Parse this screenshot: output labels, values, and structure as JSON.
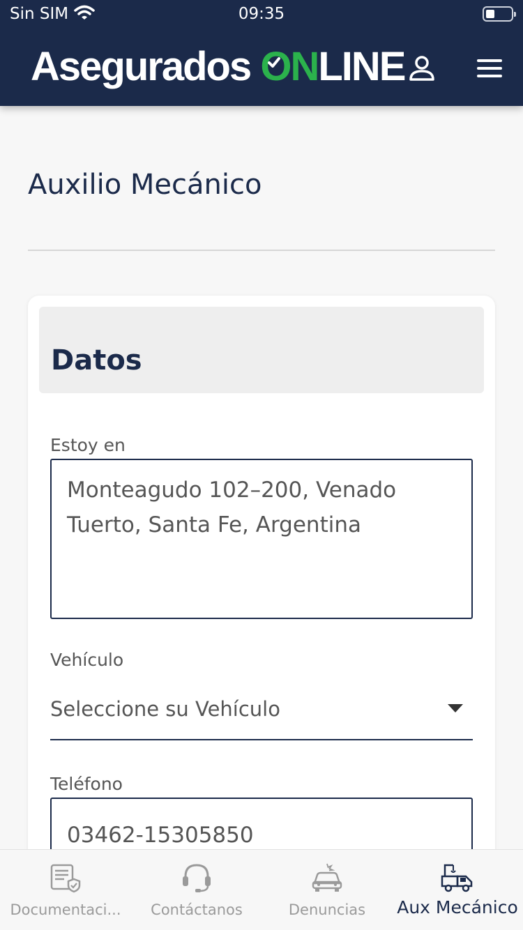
{
  "status_bar": {
    "carrier": "Sin SIM",
    "time": "09:35"
  },
  "header": {
    "logo_part1": "Asegurados",
    "logo_o": "O",
    "logo_n": "N",
    "logo_rest": "LINE",
    "icons": [
      "user-icon",
      "hamburger-menu-icon"
    ]
  },
  "page": {
    "title": "Auxilio Mecánico"
  },
  "card": {
    "section_title": "Datos",
    "location": {
      "label": "Estoy en",
      "value": "Monteagudo 102–200, Venado Tuerto, Santa Fe, Argentina"
    },
    "vehicle": {
      "label": "Vehículo",
      "selected": "Seleccione su Vehículo"
    },
    "phone": {
      "label": "Teléfono",
      "value": "03462-15305850"
    }
  },
  "tabbar": {
    "items": [
      {
        "label": "Documentaci...",
        "icon": "document-shield-icon",
        "active": false
      },
      {
        "label": "Contáctanos",
        "icon": "headset-icon",
        "active": false
      },
      {
        "label": "Denuncias",
        "icon": "car-crash-icon",
        "active": false
      },
      {
        "label": "Aux Mecánico",
        "icon": "tow-truck-icon",
        "active": true
      }
    ]
  },
  "colors": {
    "primary": "#1b2a4a",
    "accent_green": "#2bb24c",
    "background": "#f7f7f7",
    "inactive": "#9a9a9a"
  }
}
